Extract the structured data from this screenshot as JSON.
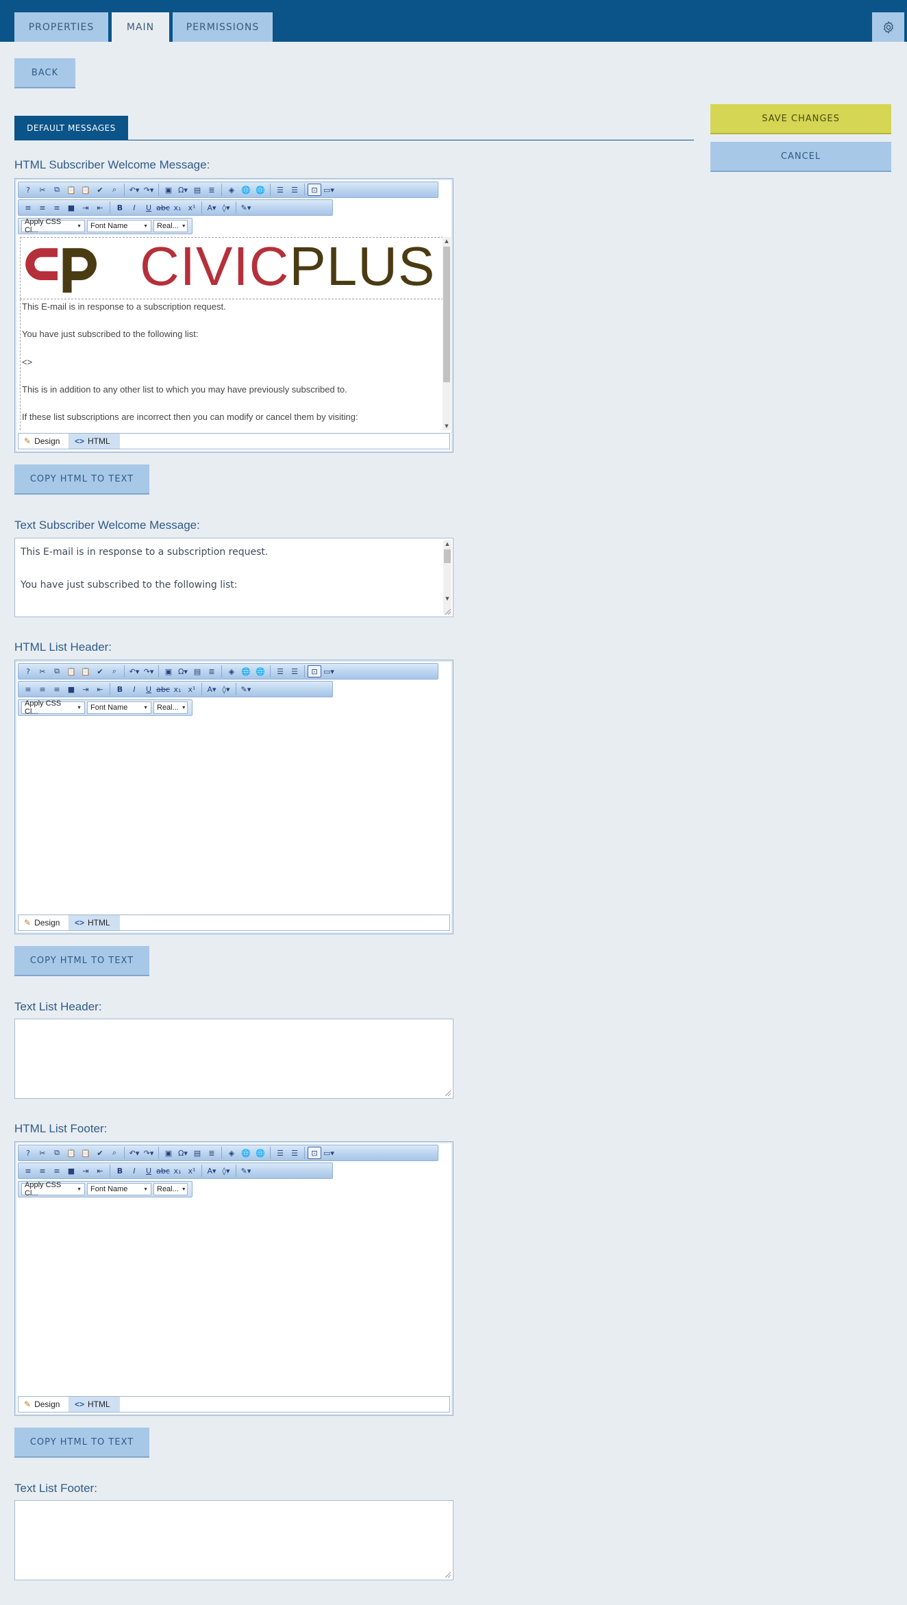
{
  "tabs": [
    {
      "label": "PROPERTIES"
    },
    {
      "label": "MAIN"
    },
    {
      "label": "PERMISSIONS"
    }
  ],
  "buttons": {
    "back": "BACK",
    "save": "SAVE CHANGES",
    "cancel": "CANCEL",
    "copy_html_to_text": "COPY HTML TO TEXT"
  },
  "section_tab": "DEFAULT MESSAGES",
  "fields": {
    "html_welcome": "HTML Subscriber Welcome Message:",
    "text_welcome": "Text Subscriber Welcome Message:",
    "html_header": "HTML List Header:",
    "text_header": "Text List Header:",
    "html_footer": "HTML List Footer:",
    "text_footer": "Text List Footer:"
  },
  "editor": {
    "dropdowns": {
      "css": "Apply CSS Cl...",
      "font": "Font Name",
      "size": "Real..."
    },
    "modes": {
      "design": "Design",
      "html": "HTML"
    }
  },
  "logo": {
    "part1": "CIVIC",
    "part2": "PLUS",
    "color1": "#b5303a",
    "color2": "#4a3b12"
  },
  "welcome_html_lines": [
    "This E-mail is in response to a subscription request.",
    "You have just subscribed to the following list:",
    "<>",
    "This is in addition to any other list to which you may have previously subscribed to.",
    "If these list subscriptions are incorrect then you can modify or cancel them by visiting:"
  ],
  "welcome_text_lines": [
    "This E-mail is in response to a subscription request.",
    "You have just subscribed to the following list:"
  ],
  "colors": {
    "topbar": "#0a5489",
    "tab": "#a8c8e8",
    "save": "#d4d654"
  }
}
